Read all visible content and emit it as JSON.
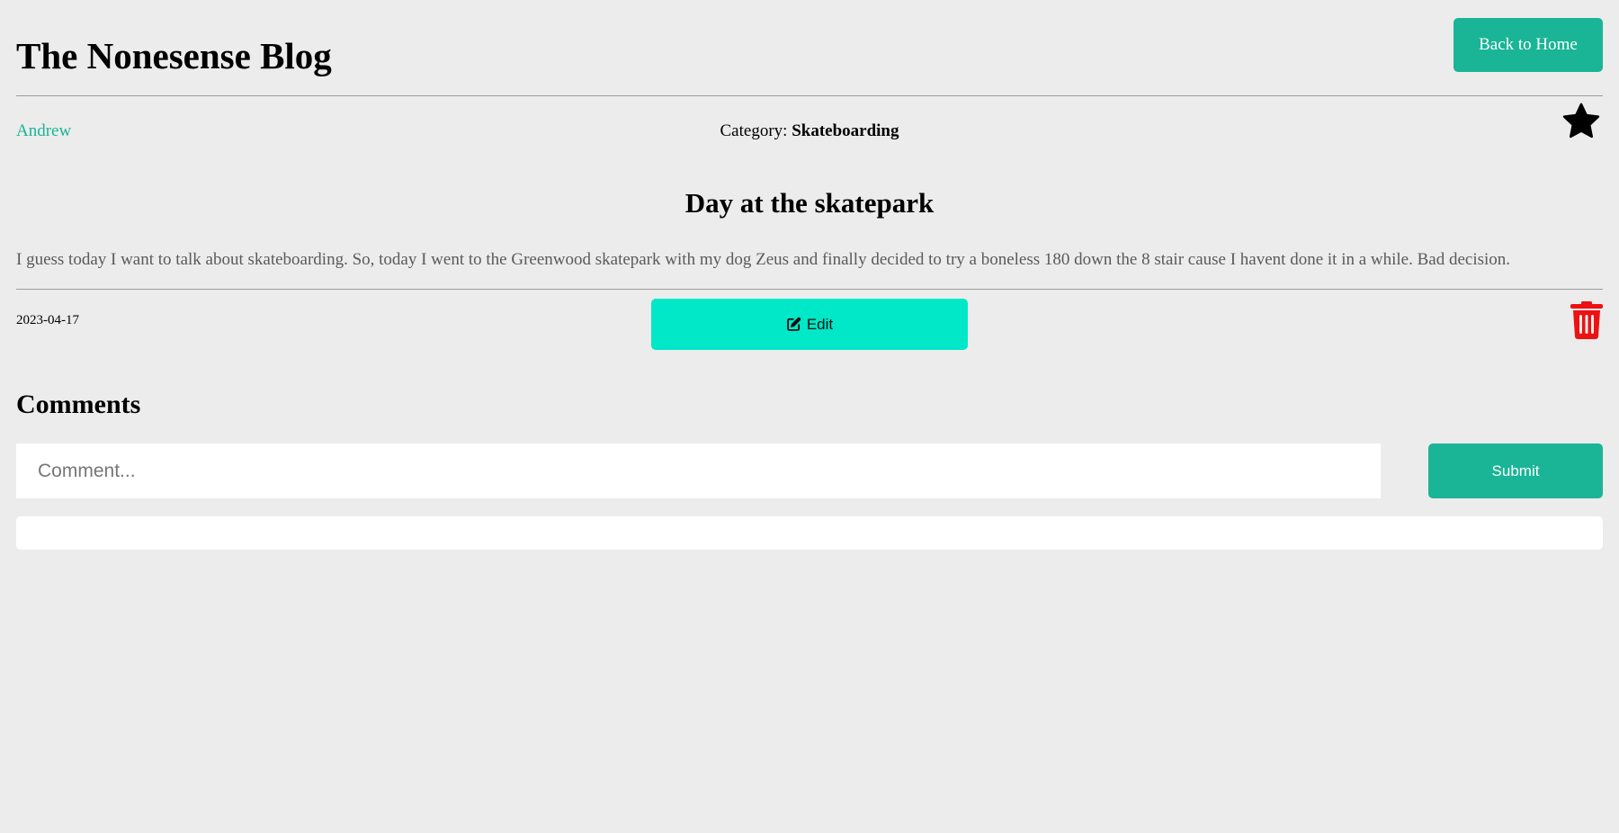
{
  "header": {
    "site_title": "The Nonesense Blog",
    "back_button_label": "Back to Home"
  },
  "meta": {
    "author": "Andrew",
    "category_label": "Category:",
    "category_value": "Skateboarding",
    "favorite_icon": "star-icon"
  },
  "post": {
    "title": "Day at the skatepark",
    "body": "I guess today I want to talk about skateboarding. So, today I went to the Greenwood skatepark with my dog Zeus and finally decided to try a boneless 180 down the 8 stair cause I havent done it in a while. Bad decision.",
    "date": "2023-04-17",
    "edit_label": "Edit",
    "edit_icon": "edit-icon",
    "delete_icon": "trash-icon"
  },
  "comments": {
    "heading": "Comments",
    "input_placeholder": "Comment...",
    "input_value": "",
    "submit_label": "Submit",
    "items": []
  },
  "colors": {
    "background": "#ececec",
    "accent": "#1ab496",
    "edit_button": "#00e8c8",
    "delete_icon": "#ee1111",
    "link": "#1ab496"
  }
}
